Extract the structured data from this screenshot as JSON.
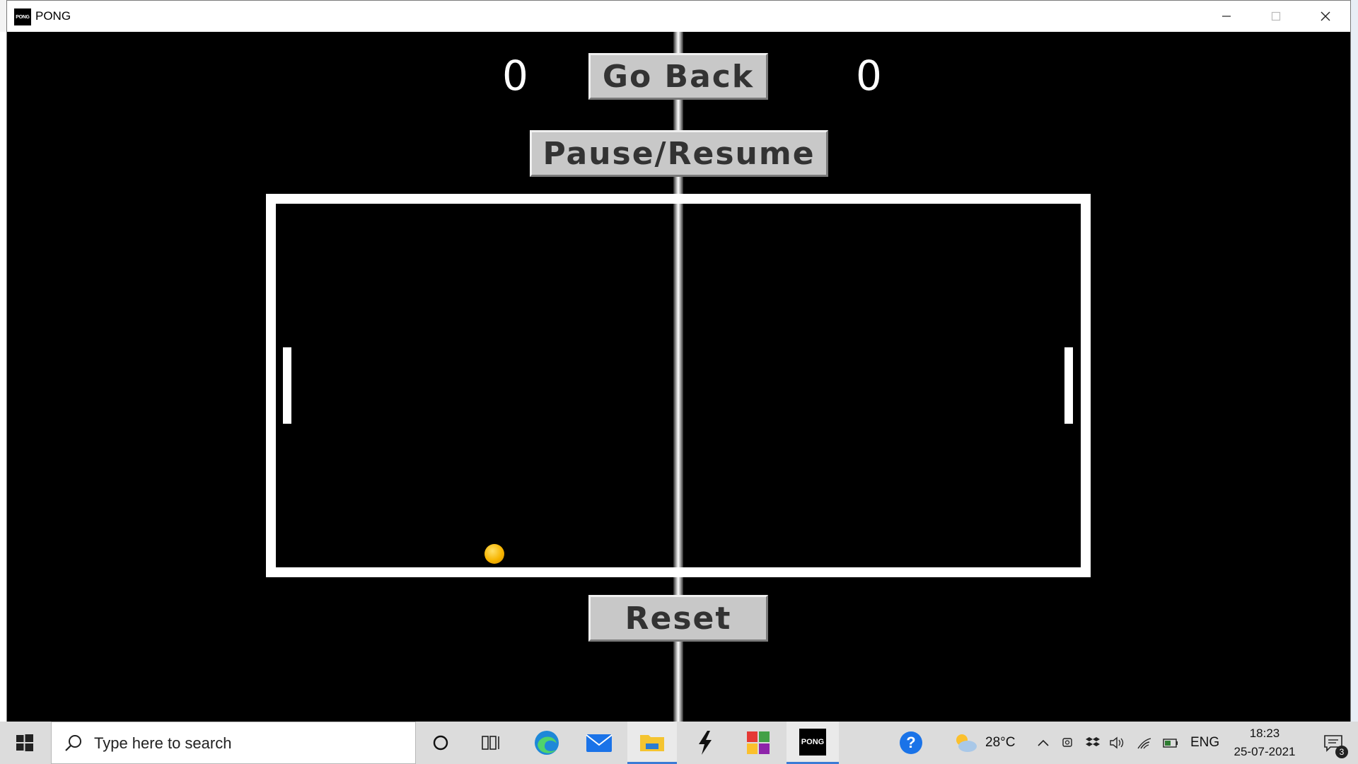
{
  "window": {
    "title": "PONG",
    "app_icon_text": "PONG"
  },
  "game": {
    "score_left": "0",
    "score_right": "0",
    "go_back_label": "Go Back",
    "pause_resume_label": "Pause/Resume",
    "reset_label": "Reset",
    "ball_color": "#f7b500"
  },
  "taskbar": {
    "search_placeholder": "Type here to search",
    "weather_temp": "28°C",
    "language": "ENG",
    "time": "18:23",
    "date": "25-07-2021",
    "notification_count": "3",
    "pong_icon_text": "PONG",
    "accent": "#3a7bd5"
  }
}
